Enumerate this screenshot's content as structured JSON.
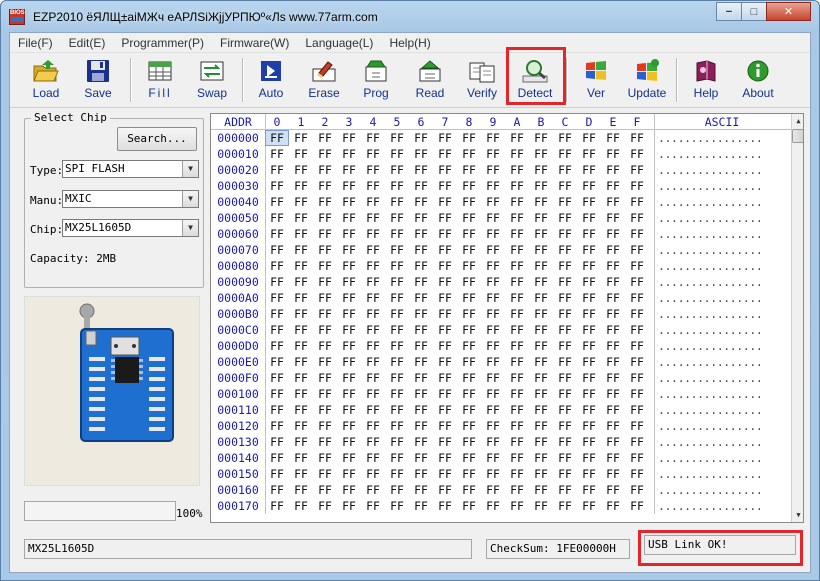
{
  "window": {
    "title": "EZP2010 ёЯЛЩ±аіМЖч еАРЛЅіЖјjУРПЮº«Лѕ www.77arm.com",
    "icon_text": "BIOS",
    "minimize": "−",
    "maximize": "□",
    "close": "✕"
  },
  "menu": [
    "File(F)",
    "Edit(E)",
    "Programmer(P)",
    "Firmware(W)",
    "Language(L)",
    "Help(H)"
  ],
  "toolbar": {
    "load": "Load",
    "save": "Save",
    "fill": "Fill",
    "swap": "Swap",
    "auto": "Auto",
    "erase": "Erase",
    "prog": "Prog",
    "read": "Read",
    "verify": "Verify",
    "detect": "Detect",
    "ver": "Ver",
    "update": "Update",
    "help": "Help",
    "about": "About"
  },
  "chip_panel": {
    "legend": "Select Chip",
    "search_button": "Search...",
    "type_label": "Type:",
    "type_value": "SPI FLASH",
    "manu_label": "Manu:",
    "manu_value": "MXIC",
    "chip_label": "Chip:",
    "chip_value": "MX25L1605D",
    "capacity": "Capacity: 2MB"
  },
  "hex_view": {
    "addr_header": "ADDR",
    "ascii_header": "ASCII",
    "columns": [
      "0",
      "1",
      "2",
      "3",
      "4",
      "5",
      "6",
      "7",
      "8",
      "9",
      "A",
      "B",
      "C",
      "D",
      "E",
      "F"
    ],
    "addresses": [
      "000000",
      "000010",
      "000020",
      "000030",
      "000040",
      "000050",
      "000060",
      "000070",
      "000080",
      "000090",
      "0000A0",
      "0000B0",
      "0000C0",
      "0000D0",
      "0000E0",
      "0000F0",
      "000100",
      "000110",
      "000120",
      "000130",
      "000140",
      "000150",
      "000160",
      "000170"
    ],
    "byte_value": "FF",
    "ascii_row": "................"
  },
  "progress": {
    "value": 0,
    "label": "100%"
  },
  "status": {
    "chip": "MX25L1605D",
    "checksum": "CheckSum: 1FE00000H",
    "usb": "USB Link OK!"
  },
  "colors": {
    "highlight": "#e3262b",
    "addr_blue": "#1a1aa8",
    "label_blue": "#12318b",
    "pcb_blue": "#1e6fd0"
  }
}
